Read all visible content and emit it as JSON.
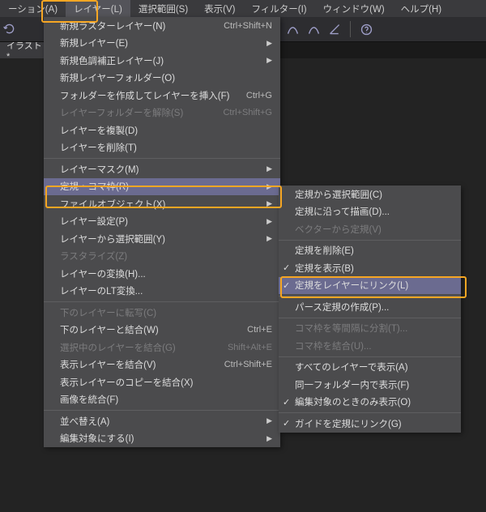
{
  "menubar": {
    "items": [
      "ーション(A)",
      "レイヤー(L)",
      "選択範囲(S)",
      "表示(V)",
      "フィルター(I)",
      "ウィンドウ(W)",
      "ヘルプ(H)",
      "",
      "",
      ""
    ]
  },
  "tab": {
    "label": "イラスト*"
  },
  "menu": {
    "items": [
      {
        "label": "新規ラスターレイヤー(N)",
        "shortcut": "Ctrl+Shift+N"
      },
      {
        "label": "新規レイヤー(E)",
        "submenu": true
      },
      {
        "label": "新規色調補正レイヤー(J)",
        "submenu": true
      },
      {
        "label": "新規レイヤーフォルダー(O)"
      },
      {
        "label": "フォルダーを作成してレイヤーを挿入(F)",
        "shortcut": "Ctrl+G"
      },
      {
        "label": "レイヤーフォルダーを解除(S)",
        "shortcut": "Ctrl+Shift+G",
        "disabled": true
      },
      {
        "label": "レイヤーを複製(D)"
      },
      {
        "label": "レイヤーを削除(T)"
      },
      {
        "sep": true
      },
      {
        "label": "レイヤーマスク(M)",
        "submenu": true
      },
      {
        "label": "定規・コマ枠(R)",
        "submenu": true,
        "hover": true
      },
      {
        "label": "ファイルオブジェクト(X)",
        "submenu": true
      },
      {
        "label": "レイヤー設定(P)",
        "submenu": true
      },
      {
        "label": "レイヤーから選択範囲(Y)",
        "submenu": true
      },
      {
        "label": "ラスタライズ(Z)",
        "disabled": true
      },
      {
        "label": "レイヤーの変換(H)..."
      },
      {
        "label": "レイヤーのLT変換..."
      },
      {
        "sep": true
      },
      {
        "label": "下のレイヤーに転写(C)",
        "disabled": true
      },
      {
        "label": "下のレイヤーと結合(W)",
        "shortcut": "Ctrl+E"
      },
      {
        "label": "選択中のレイヤーを結合(G)",
        "shortcut": "Shift+Alt+E",
        "disabled": true
      },
      {
        "label": "表示レイヤーを結合(V)",
        "shortcut": "Ctrl+Shift+E"
      },
      {
        "label": "表示レイヤーのコピーを結合(X)"
      },
      {
        "label": "画像を統合(F)"
      },
      {
        "sep": true
      },
      {
        "label": "並べ替え(A)",
        "submenu": true
      },
      {
        "label": "編集対象にする(I)",
        "submenu": true
      }
    ]
  },
  "submenu": {
    "items": [
      {
        "label": "定規から選択範囲(C)"
      },
      {
        "label": "定規に沿って描画(D)..."
      },
      {
        "label": "ベクターから定規(V)",
        "disabled": true
      },
      {
        "sep": true
      },
      {
        "label": "定規を削除(E)"
      },
      {
        "label": "定規を表示(B)",
        "check": true
      },
      {
        "label": "定規をレイヤーにリンク(L)",
        "check": true,
        "hover": true
      },
      {
        "sep": true
      },
      {
        "label": "パース定規の作成(P)..."
      },
      {
        "sep": true
      },
      {
        "label": "コマ枠を等間隔に分割(T)...",
        "disabled": true
      },
      {
        "label": "コマ枠を結合(U)...",
        "disabled": true
      },
      {
        "sep": true
      },
      {
        "label": "すべてのレイヤーで表示(A)"
      },
      {
        "label": "同一フォルダー内で表示(F)"
      },
      {
        "label": "編集対象のときのみ表示(O)",
        "check": true
      },
      {
        "sep": true
      },
      {
        "label": "ガイドを定規にリンク(G)",
        "check": true
      }
    ]
  }
}
